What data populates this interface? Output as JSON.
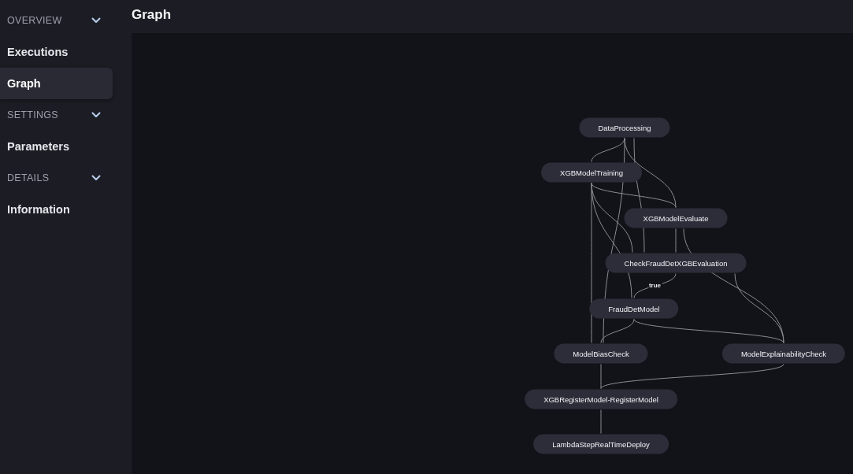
{
  "sidebar": {
    "sections": [
      {
        "label": "OVERVIEW",
        "expanded": true,
        "items": [
          {
            "label": "Executions",
            "selected": false
          },
          {
            "label": "Graph",
            "selected": true
          }
        ]
      },
      {
        "label": "SETTINGS",
        "expanded": true,
        "items": [
          {
            "label": "Parameters",
            "selected": false
          }
        ]
      },
      {
        "label": "DETAILS",
        "expanded": true,
        "items": [
          {
            "label": "Information",
            "selected": false
          }
        ]
      }
    ]
  },
  "page": {
    "title": "Graph"
  },
  "graph": {
    "nodes": [
      {
        "label": "DataProcessing"
      },
      {
        "label": "XGBModelTraining"
      },
      {
        "label": "XGBModelEvaluate"
      },
      {
        "label": "CheckFraudDetXGBEvaluation"
      },
      {
        "label": "FraudDetModel"
      },
      {
        "label": "ModelBiasCheck"
      },
      {
        "label": "ModelExplainabilityCheck"
      },
      {
        "label": "XGBRegisterModel-RegisterModel"
      },
      {
        "label": "LambdaStepRealTimeDeploy"
      }
    ],
    "edge_labels": [
      "true"
    ]
  }
}
